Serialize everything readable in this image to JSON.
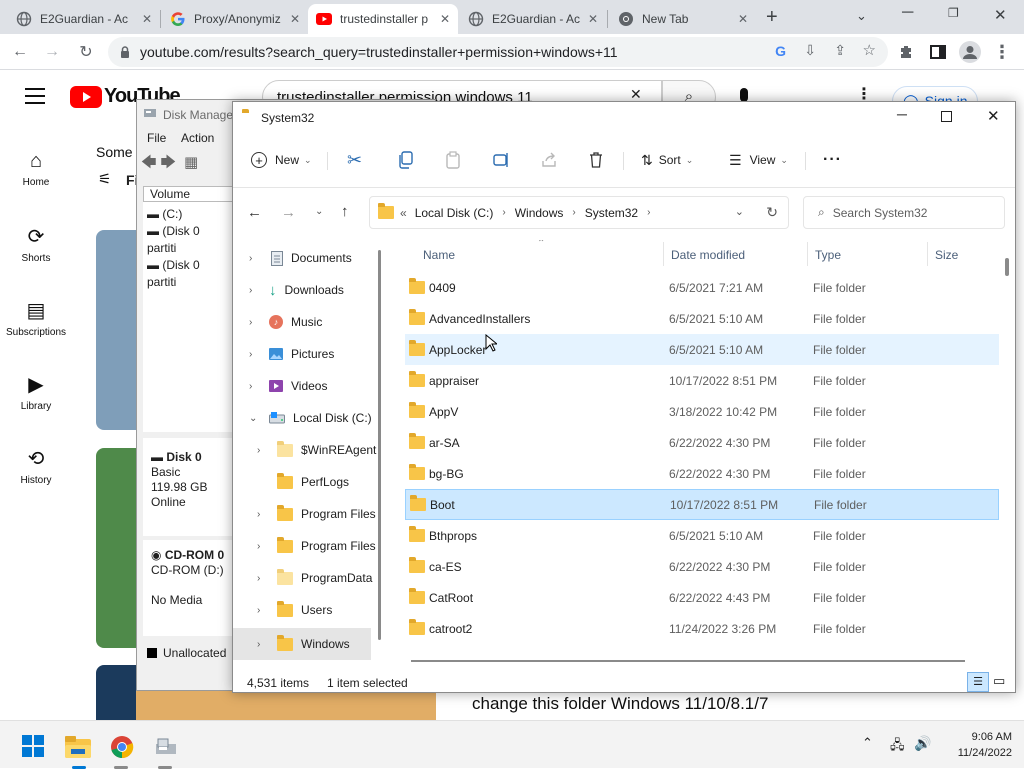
{
  "browser": {
    "tabs": [
      {
        "title": "E2Guardian - Ac",
        "icon": "globe-icon"
      },
      {
        "title": "Proxy/Anonymiz",
        "icon": "google-icon"
      },
      {
        "title": "trustedinstaller p",
        "icon": "youtube-icon"
      },
      {
        "title": "E2Guardian - Ac",
        "icon": "globe-icon"
      },
      {
        "title": "New Tab",
        "icon": "chrome-icon"
      }
    ],
    "url": "youtube.com/results?search_query=trustedinstaller+permission+windows+11"
  },
  "youtube": {
    "logo": "YouTube",
    "search_text": "trustedinstaller permission windows 11",
    "signin": "Sign in",
    "nav": [
      "Home",
      "Shorts",
      "Subscriptions",
      "Library",
      "History"
    ],
    "some_text": "Some",
    "filter_text": "Fi",
    "video_caption": "change this folder Windows 11/10/8.1/7"
  },
  "diskmgmt": {
    "title": "Disk Manage",
    "menu": [
      "File",
      "Action"
    ],
    "col_volume": "Volume",
    "volumes": [
      "(C:)",
      "(Disk 0 partiti",
      "(Disk 0 partiti"
    ],
    "disk0": {
      "name": "Disk 0",
      "type": "Basic",
      "size": "119.98 GB",
      "status": "Online"
    },
    "cdrom": {
      "name": "CD-ROM 0",
      "drive": "CD-ROM (D:)",
      "media": "No Media"
    },
    "legend": "Unallocated"
  },
  "explorer": {
    "title": "System32",
    "commands": {
      "new": "New",
      "sort": "Sort",
      "view": "View"
    },
    "breadcrumb": [
      "Local Disk (C:)",
      "Windows",
      "System32"
    ],
    "search_placeholder": "Search System32",
    "nav": [
      {
        "label": "Documents",
        "icon": "documents-icon"
      },
      {
        "label": "Downloads",
        "icon": "downloads-icon"
      },
      {
        "label": "Music",
        "icon": "music-icon"
      },
      {
        "label": "Pictures",
        "icon": "pictures-icon"
      },
      {
        "label": "Videos",
        "icon": "videos-icon"
      },
      {
        "label": "Local Disk (C:)",
        "icon": "drive-icon"
      },
      {
        "label": "$WinREAgent",
        "icon": "folder-icon"
      },
      {
        "label": "PerfLogs",
        "icon": "folder-icon"
      },
      {
        "label": "Program Files",
        "icon": "folder-icon"
      },
      {
        "label": "Program Files",
        "icon": "folder-icon"
      },
      {
        "label": "ProgramData",
        "icon": "folder-icon"
      },
      {
        "label": "Users",
        "icon": "folder-icon"
      },
      {
        "label": "Windows",
        "icon": "folder-icon"
      }
    ],
    "columns": {
      "name": "Name",
      "date": "Date modified",
      "type": "Type",
      "size": "Size"
    },
    "files": [
      {
        "name": "0409",
        "date": "6/5/2021 7:21 AM",
        "type": "File folder"
      },
      {
        "name": "AdvancedInstallers",
        "date": "6/5/2021 5:10 AM",
        "type": "File folder"
      },
      {
        "name": "AppLocker",
        "date": "6/5/2021 5:10 AM",
        "type": "File folder"
      },
      {
        "name": "appraiser",
        "date": "10/17/2022 8:51 PM",
        "type": "File folder"
      },
      {
        "name": "AppV",
        "date": "3/18/2022 10:42 PM",
        "type": "File folder"
      },
      {
        "name": "ar-SA",
        "date": "6/22/2022 4:30 PM",
        "type": "File folder"
      },
      {
        "name": "bg-BG",
        "date": "6/22/2022 4:30 PM",
        "type": "File folder"
      },
      {
        "name": "Boot",
        "date": "10/17/2022 8:51 PM",
        "type": "File folder"
      },
      {
        "name": "Bthprops",
        "date": "6/5/2021 5:10 AM",
        "type": "File folder"
      },
      {
        "name": "ca-ES",
        "date": "6/22/2022 4:30 PM",
        "type": "File folder"
      },
      {
        "name": "CatRoot",
        "date": "6/22/2022 4:43 PM",
        "type": "File folder"
      },
      {
        "name": "catroot2",
        "date": "11/24/2022 3:26 PM",
        "type": "File folder"
      }
    ],
    "status_count": "4,531 items",
    "status_selected": "1 item selected"
  },
  "taskbar": {
    "time": "9:06 AM",
    "date": "11/24/2022"
  },
  "colors": {
    "accent": "#0067c0",
    "youtube_red": "#ff0000",
    "selection": "#cce8ff"
  }
}
